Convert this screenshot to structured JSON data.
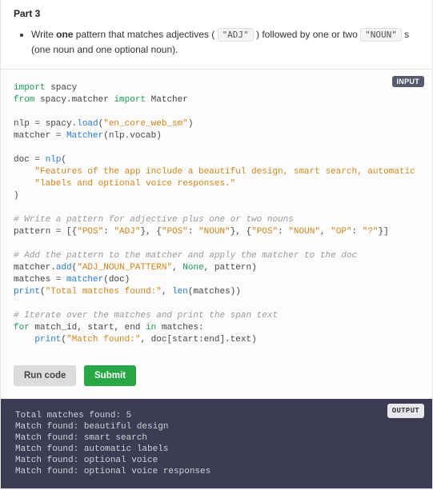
{
  "part": {
    "title": "Part 3",
    "instruction_prefix": "Write ",
    "instruction_bold": "one",
    "instruction_mid1": " pattern that matches adjectives ( ",
    "chip_adj": "\"ADJ\"",
    "instruction_mid2": " ) followed by one or two ",
    "chip_noun": "\"NOUN\"",
    "instruction_suffix": " s (one noun and one optional noun)."
  },
  "labels": {
    "input_tag": "INPUT",
    "output_tag": "OUTPUT",
    "run": "Run code",
    "submit": "Submit"
  },
  "code": {
    "l1_import": "import",
    "l1_spacy": " spacy",
    "l2_from": "from",
    "l2_mod": " spacy.matcher ",
    "l2_import": "import",
    "l2_target": " Matcher",
    "l4_lhs": "nlp = spacy.",
    "l4_fn": "load",
    "l4_p1": "(",
    "l4_str": "\"en_core_web_sm\"",
    "l4_p2": ")",
    "l5_lhs": "matcher = ",
    "l5_fn": "Matcher",
    "l5_args": "(nlp.vocab)",
    "l7_lhs": "doc = ",
    "l7_fn": "nlp",
    "l7_open": "(",
    "l8_str": "    \"Features of the app include a beautiful design, smart search, automatic \"",
    "l9_str": "    \"labels and optional voice responses.\"",
    "l10_close": ")",
    "c1": "# Write a pattern for adjective plus one or two nouns",
    "l12_lhs": "pattern = [{",
    "l12_k1": "\"POS\"",
    "l12_c1": ": ",
    "l12_v1": "\"ADJ\"",
    "l12_c2": "}, {",
    "l12_k2": "\"POS\"",
    "l12_c3": ": ",
    "l12_v2": "\"NOUN\"",
    "l12_c4": "}, {",
    "l12_k3": "\"POS\"",
    "l12_c5": ": ",
    "l12_v3": "\"NOUN\"",
    "l12_c6": ", ",
    "l12_k4": "\"OP\"",
    "l12_c7": ": ",
    "l12_v4": "\"?\"",
    "l12_end": "}]",
    "c2": "# Add the pattern to the matcher and apply the matcher to the doc",
    "l14_lhs": "matcher.",
    "l14_fn": "add",
    "l14_open": "(",
    "l14_s1": "\"ADJ_NOUN_PATTERN\"",
    "l14_c1": ", ",
    "l14_none": "None",
    "l14_c2": ", pattern)",
    "l15_lhs": "matches = ",
    "l15_fn": "matcher",
    "l15_args": "(doc)",
    "l16_fn": "print",
    "l16_open": "(",
    "l16_s1": "\"Total matches found:\"",
    "l16_c1": ", ",
    "l16_len": "len",
    "l16_args": "(matches))",
    "c3": "# Iterate over the matches and print the span text",
    "l18_for": "for",
    "l18_vars": " match_id, start, end ",
    "l18_in": "in",
    "l18_iter": " matches:",
    "l19_indent": "    ",
    "l19_fn": "print",
    "l19_open": "(",
    "l19_s1": "\"Match found:\"",
    "l19_c1": ", doc[start:end].text)"
  },
  "output": {
    "lines": "Total matches found: 5\nMatch found: beautiful design\nMatch found: smart search\nMatch found: automatic labels\nMatch found: optional voice\nMatch found: optional voice responses"
  }
}
